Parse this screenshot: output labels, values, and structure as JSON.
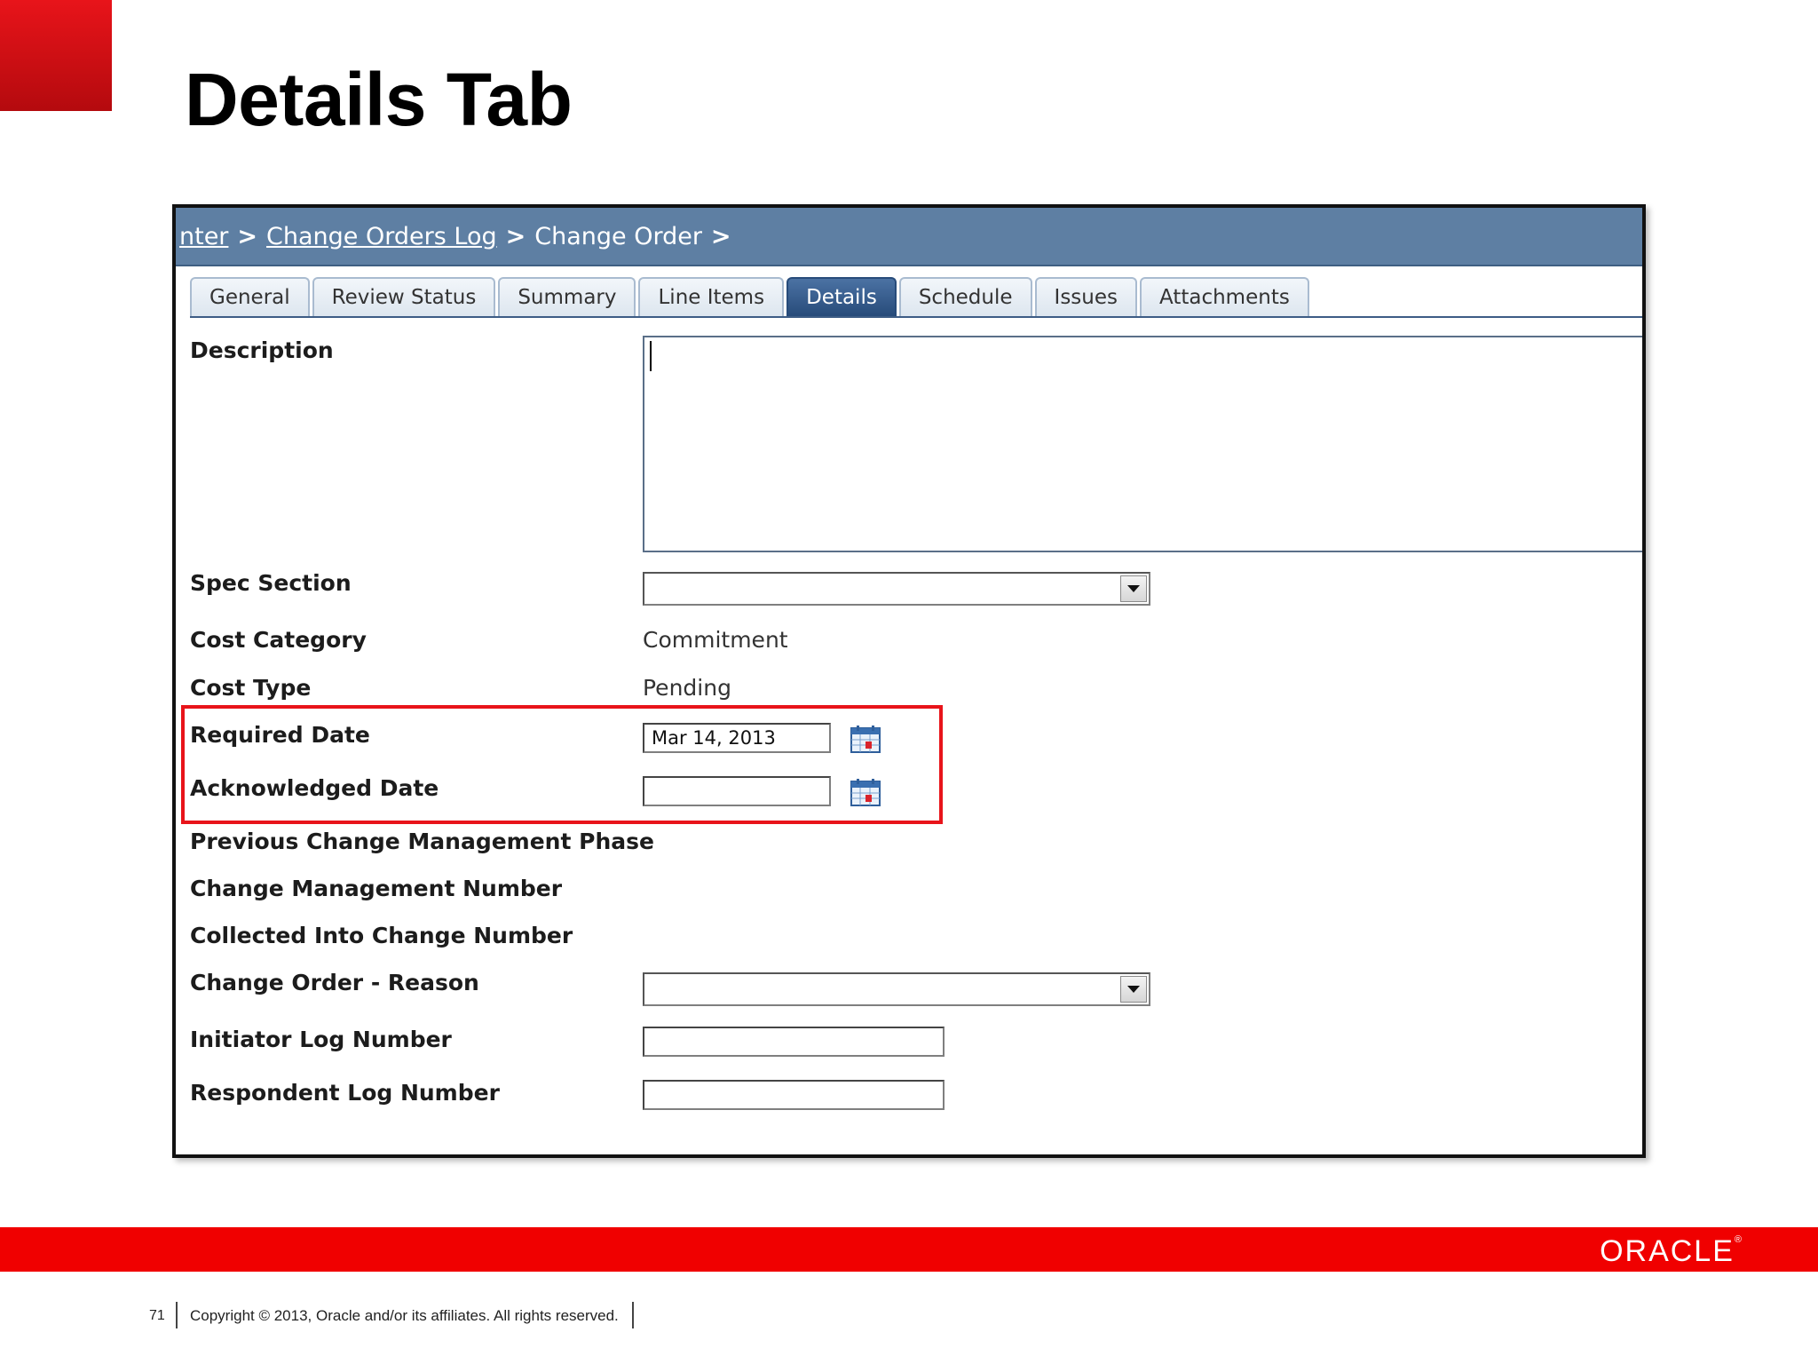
{
  "slide": {
    "title": "Details Tab",
    "page_number": "71",
    "copyright": "Copyright © 2013, Oracle and/or its affiliates. All rights reserved.",
    "logo_text": "ORACLE",
    "accent_color": "#e8141a"
  },
  "breadcrumb": {
    "items": [
      {
        "label": "nter",
        "link": true
      },
      {
        "label": "Change Orders Log",
        "link": true
      },
      {
        "label": "Change Order",
        "link": false
      }
    ],
    "separator": ">"
  },
  "tabs": [
    {
      "label": "General",
      "active": false
    },
    {
      "label": "Review Status",
      "active": false
    },
    {
      "label": "Summary",
      "active": false
    },
    {
      "label": "Line Items",
      "active": false
    },
    {
      "label": "Details",
      "active": true
    },
    {
      "label": "Schedule",
      "active": false
    },
    {
      "label": "Issues",
      "active": false
    },
    {
      "label": "Attachments",
      "active": false
    }
  ],
  "fields": {
    "description": {
      "label": "Description",
      "value": ""
    },
    "spec_section": {
      "label": "Spec Section",
      "value": ""
    },
    "cost_category": {
      "label": "Cost Category",
      "value": "Commitment"
    },
    "cost_type": {
      "label": "Cost Type",
      "value": "Pending"
    },
    "required_date": {
      "label": "Required Date",
      "value": "Mar 14, 2013"
    },
    "acknowledged_date": {
      "label": "Acknowledged Date",
      "value": ""
    },
    "previous_phase": {
      "label": "Previous Change Management Phase"
    },
    "change_mgmt_number": {
      "label": "Change Management Number"
    },
    "collected_into": {
      "label": "Collected Into Change Number"
    },
    "reason": {
      "label": "Change Order - Reason",
      "value": ""
    },
    "initiator_log": {
      "label": "Initiator Log Number",
      "value": ""
    },
    "respondent_log": {
      "label": "Respondent Log Number",
      "value": ""
    }
  }
}
